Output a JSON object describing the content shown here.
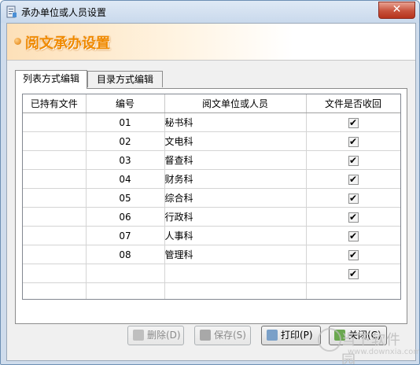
{
  "window": {
    "title": "承办单位或人员设置",
    "close_glyph": "✕"
  },
  "banner": {
    "title": "阅文承办设置"
  },
  "tabs": [
    {
      "label": "列表方式编辑",
      "active": true
    },
    {
      "label": "目录方式编辑",
      "active": false
    }
  ],
  "table": {
    "headers": [
      "已持有文件",
      "编号",
      "阅文单位或人员",
      "文件是否收回"
    ],
    "rows": [
      {
        "held": "",
        "num": "01",
        "unit": "秘书科",
        "returned": true
      },
      {
        "held": "",
        "num": "02",
        "unit": "文电科",
        "returned": true
      },
      {
        "held": "",
        "num": "03",
        "unit": "督查科",
        "returned": true
      },
      {
        "held": "",
        "num": "04",
        "unit": "财务科",
        "returned": true
      },
      {
        "held": "",
        "num": "05",
        "unit": "综合科",
        "returned": true
      },
      {
        "held": "",
        "num": "06",
        "unit": "行政科",
        "returned": true
      },
      {
        "held": "",
        "num": "07",
        "unit": "人事科",
        "returned": true
      },
      {
        "held": "",
        "num": "08",
        "unit": "管理科",
        "returned": true
      },
      {
        "held": "",
        "num": "",
        "unit": "",
        "returned": true
      }
    ]
  },
  "buttons": {
    "delete": "删除(D)",
    "save": "保存(S)",
    "print": "打印(P)",
    "close": "关闭(C)"
  },
  "watermark": {
    "text": "当下软件园",
    "url": "www.downxia.com"
  },
  "colors": {
    "banner_text": "#f08a00",
    "close_button": "#c7513b"
  }
}
